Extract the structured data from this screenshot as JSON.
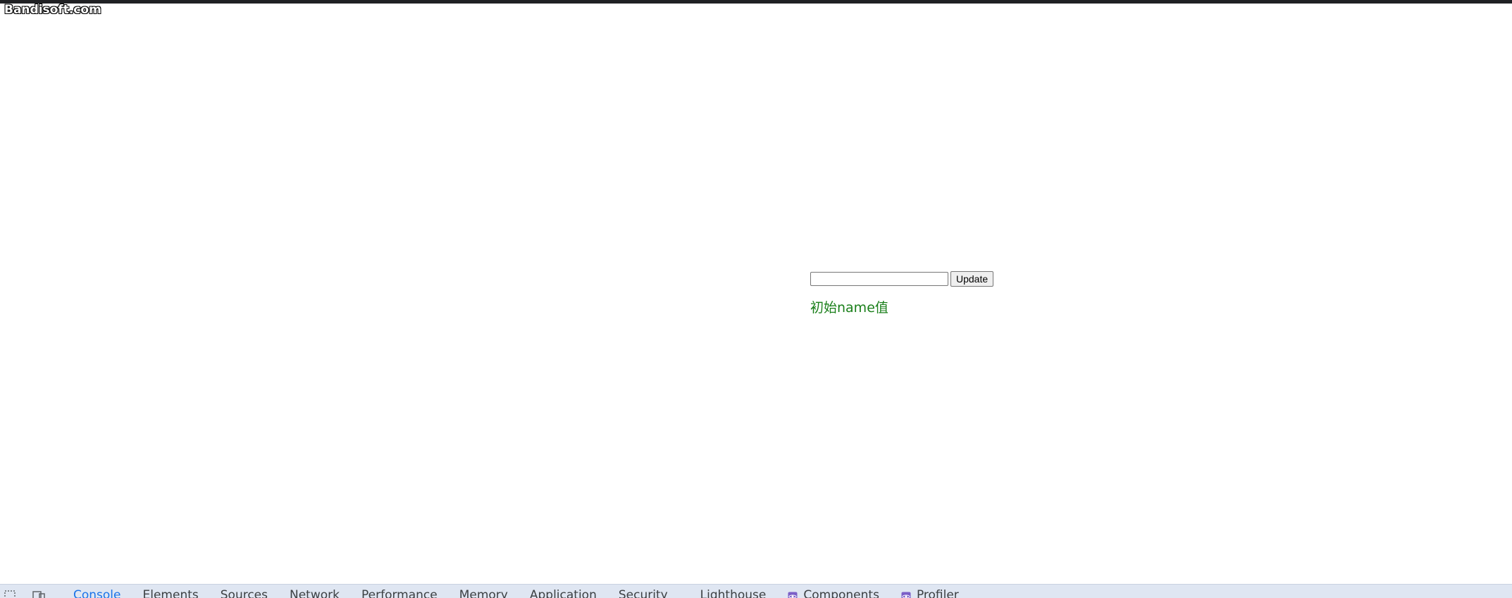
{
  "watermark": {
    "text": "Bandisoft.com"
  },
  "app": {
    "input_value": "",
    "input_placeholder": "",
    "update_label": "Update",
    "name_text": "初始name值",
    "name_color": "#1a7f1a"
  },
  "devtools": {
    "tabs": [
      {
        "label": "Console",
        "active": true
      },
      {
        "label": "Elements"
      },
      {
        "label": "Sources"
      },
      {
        "label": "Network"
      },
      {
        "label": "Performance"
      },
      {
        "label": "Memory"
      },
      {
        "label": "Application"
      },
      {
        "label": "Security"
      },
      {
        "label": "Lighthouse"
      },
      {
        "label": "Components",
        "icon": "react-icon"
      },
      {
        "label": "Profiler",
        "icon": "react-icon"
      }
    ],
    "icons": [
      "inspect-element-icon",
      "device-toolbar-icon"
    ],
    "accent_color": "#1a73e8"
  }
}
